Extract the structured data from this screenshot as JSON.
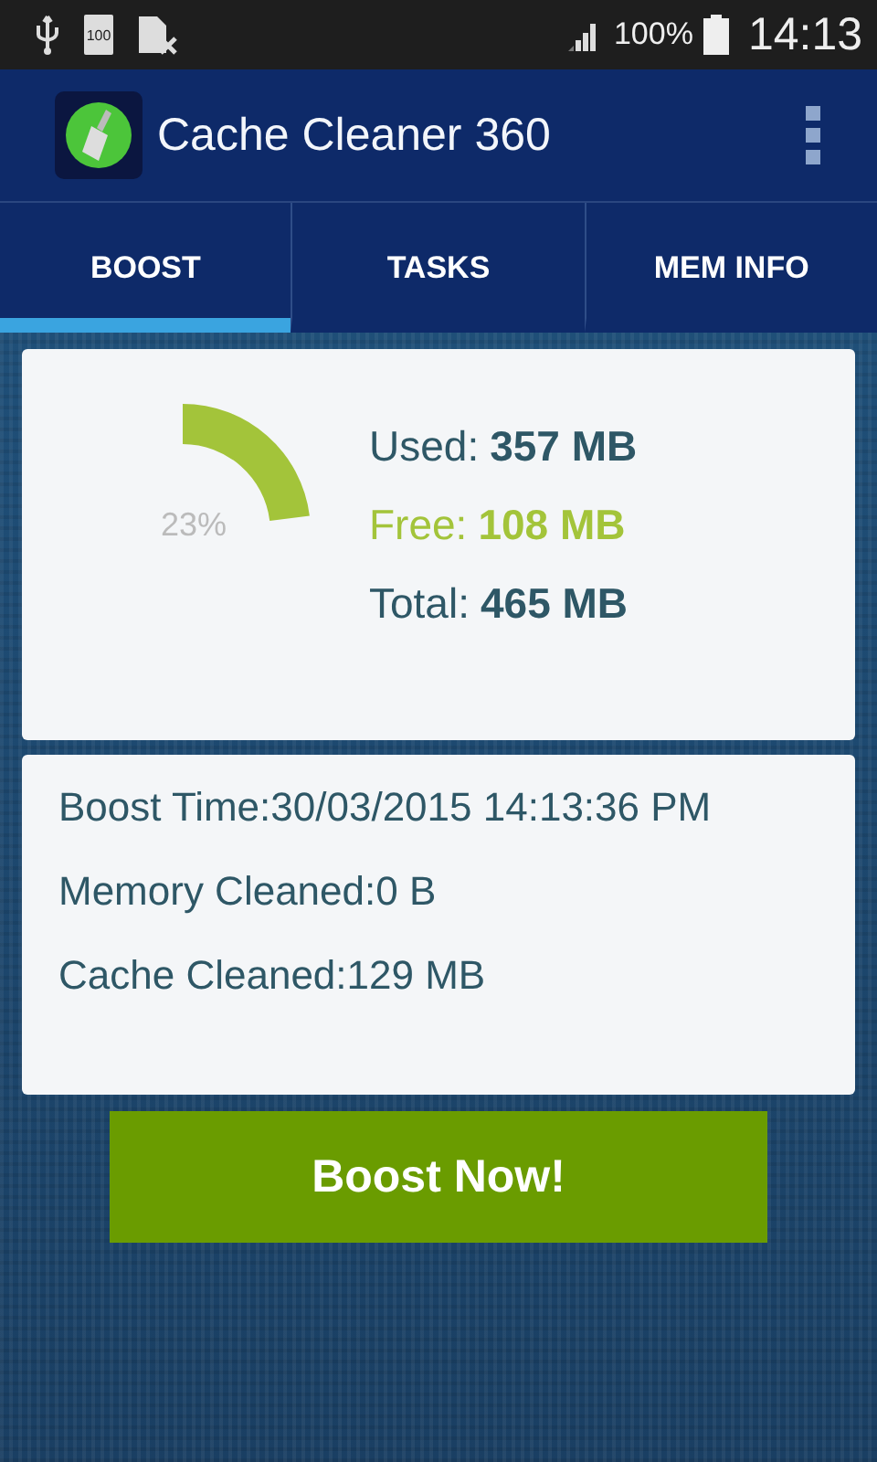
{
  "status_bar": {
    "battery_text": "100",
    "signal_text": "100%",
    "time": "14:13"
  },
  "app_bar": {
    "title": "Cache Cleaner 360"
  },
  "tabs": [
    {
      "label": "BOOST",
      "selected": true
    },
    {
      "label": "TASKS",
      "selected": false
    },
    {
      "label": "MEM INFO",
      "selected": false
    }
  ],
  "memory": {
    "gauge_label": "23%",
    "stats": [
      {
        "kind": "used",
        "label": "Used:",
        "value": "357 MB"
      },
      {
        "kind": "free",
        "label": "Free:",
        "value": "108 MB"
      },
      {
        "kind": "total",
        "label": "Total:",
        "value": "465 MB"
      }
    ]
  },
  "info": [
    {
      "label": "Boost Time:",
      "value": "30/03/2015 14:13:36 PM"
    },
    {
      "label": "Memory Cleaned:",
      "value": "0 B"
    },
    {
      "label": "Cache Cleaned:",
      "value": "129 MB"
    }
  ],
  "boost_button": "Boost Now!"
}
